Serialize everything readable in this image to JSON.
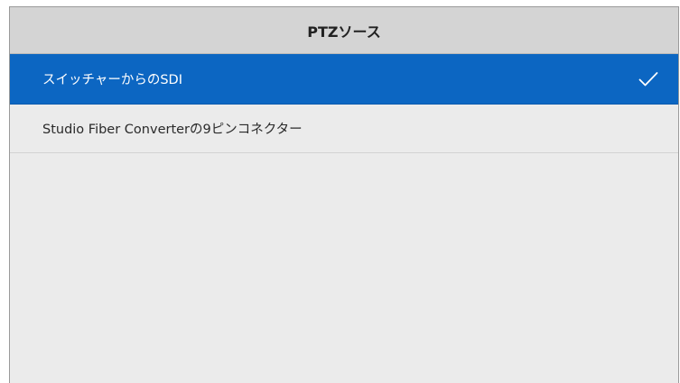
{
  "header": {
    "title": "PTZソース"
  },
  "options": [
    {
      "label": "スイッチャーからのSDI",
      "selected": true,
      "icon": "checkmark-icon"
    },
    {
      "label": "Studio Fiber Converterの9ピンコネクター",
      "selected": false
    }
  ],
  "colors": {
    "selected_bg": "#0c66c2",
    "header_bg": "#d4d4d4",
    "panel_bg": "#ebebeb"
  }
}
